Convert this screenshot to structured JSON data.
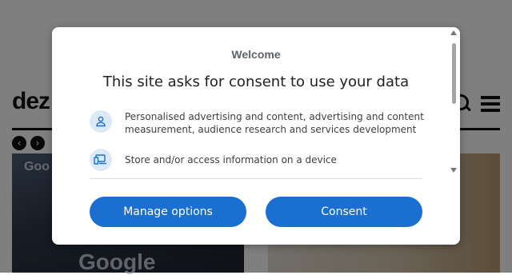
{
  "background": {
    "logo_text": "dez",
    "image1_tag": "Goo",
    "image1_word": "Google",
    "prev_arrow": "‹",
    "next_arrow": "›"
  },
  "consent": {
    "welcome": "Welcome",
    "headline": "This site asks for consent to use your data",
    "purposes": [
      {
        "icon": "person-icon",
        "text": "Personalised advertising and content, advertising and content measurement, audience research and services development"
      },
      {
        "icon": "devices-icon",
        "text": "Store and/or access information on a device"
      }
    ],
    "manage_label": "Manage options",
    "consent_label": "Consent",
    "accent_color": "#1a6fd1"
  }
}
